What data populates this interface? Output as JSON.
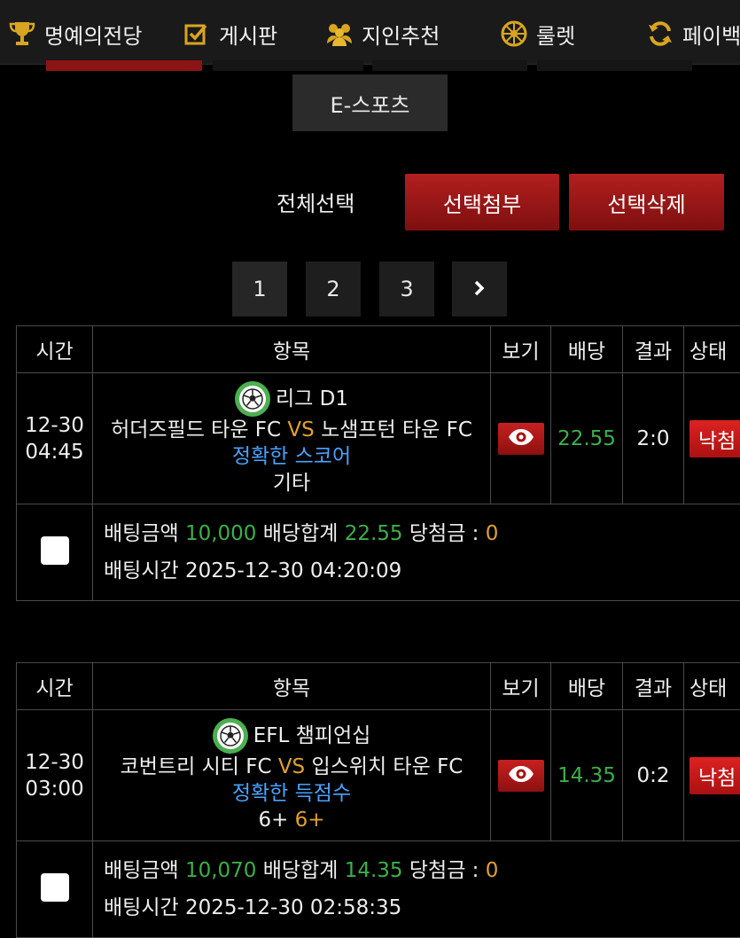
{
  "nav": {
    "items": [
      {
        "label": "명예의전당",
        "icon": "trophy-icon"
      },
      {
        "label": "게시판",
        "icon": "checkbox-icon"
      },
      {
        "label": "지인추천",
        "icon": "people-icon"
      },
      {
        "label": "룰렛",
        "icon": "roulette-icon"
      },
      {
        "label": "페이백",
        "icon": "refresh-icon"
      }
    ]
  },
  "tab": {
    "esports": "E-스포츠"
  },
  "actions": {
    "select_all": "전체선택",
    "attach": "선택첨부",
    "delete": "선택삭제"
  },
  "pagination": {
    "pages": [
      "1",
      "2",
      "3"
    ],
    "next": "›"
  },
  "headers": {
    "time": "시간",
    "item": "항목",
    "view": "보기",
    "odds": "배당",
    "result": "결과",
    "status": "상태"
  },
  "labels": {
    "amount": "배팅금액",
    "total_odds": "배당합계",
    "winnings": "당첨금 :",
    "bet_time": "배팅시간",
    "vs": "VS"
  },
  "bets": [
    {
      "date": "12-30",
      "time": "04:45",
      "league": "리그 D1",
      "home": "허더즈필드 타운 FC",
      "away": "노샘프턴 타운 FC",
      "market": "정확한 스코어",
      "pick_main": "기타",
      "pick_hl": "",
      "odds": "22.55",
      "result": "2:0",
      "status": "낙첨",
      "amount": "10,000",
      "total_odds": "22.55",
      "winnings": "0",
      "bet_time": "2025-12-30 04:20:09"
    },
    {
      "date": "12-30",
      "time": "03:00",
      "league": "EFL 챔피언십",
      "home": "코번트리 시티 FC",
      "away": "입스위치 타운 FC",
      "market": "정확한 득점수",
      "pick_main": "6+",
      "pick_hl": "6+",
      "odds": "14.35",
      "result": "0:2",
      "status": "낙첨",
      "amount": "10,070",
      "total_odds": "14.35",
      "winnings": "0",
      "bet_time": "2025-12-30 02:58:35"
    }
  ],
  "colors": {
    "accent_red": "#b21f1f",
    "odds_green": "#3cb04a",
    "vs_orange": "#e0a030",
    "market_blue": "#4aa3ff"
  }
}
